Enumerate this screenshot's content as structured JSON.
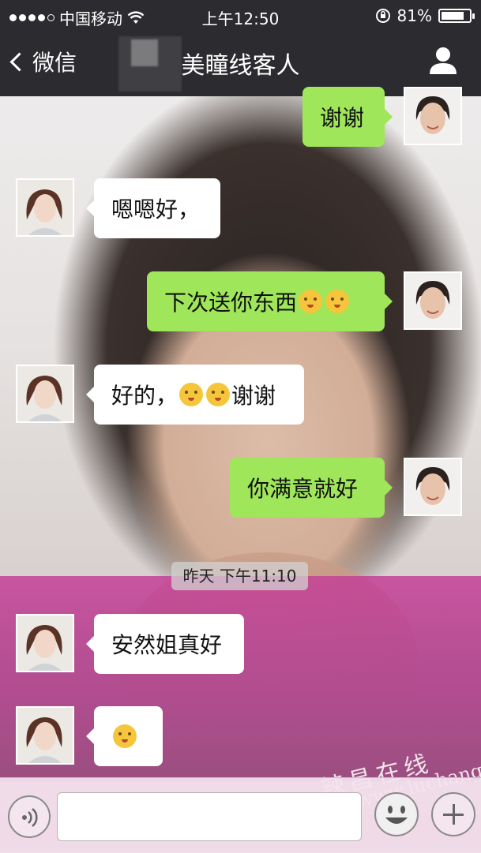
{
  "status_bar": {
    "carrier": "中国移动",
    "time": "上午12:50",
    "battery_percent": "81%",
    "battery_level": 0.81
  },
  "nav": {
    "back_label": "微信",
    "title": "美瞳线客人"
  },
  "messages": [
    {
      "side": "out",
      "text": "谢谢"
    },
    {
      "side": "in",
      "text": "嗯嗯好，"
    },
    {
      "side": "out",
      "text": "下次送你东西",
      "emojis": 2
    },
    {
      "side": "in",
      "text_before": "好的，",
      "emojis": 2,
      "text_after": "谢谢"
    },
    {
      "side": "out",
      "text": "你满意就好"
    },
    {
      "side": "in",
      "text": "安然姐真好"
    },
    {
      "side": "in",
      "emojis": 1
    }
  ],
  "timestamp": "昨天 下午11:10",
  "watermark": {
    "text": "辣昌在线",
    "url": "www.luchang.org"
  },
  "colors": {
    "nav_bg": "#2c2b2f",
    "bubble_out": "#9fe65a",
    "bubble_in": "#ffffff"
  },
  "icons": [
    "wifi-icon",
    "rotation-lock-icon",
    "battery-icon",
    "back-chevron-icon",
    "profile-icon",
    "voice-icon",
    "emoji-icon",
    "plus-icon"
  ]
}
